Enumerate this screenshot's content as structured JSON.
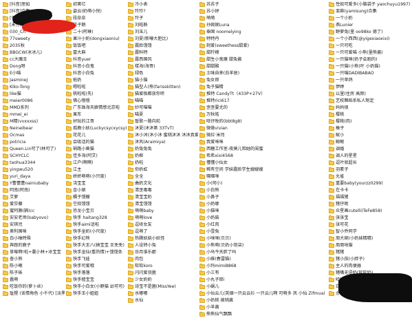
{
  "columns": [
    [
      "[抖音]思如",
      "[抖音]合集",
      "[平台]-抖音号",
      "[未分类]合集",
      "030_Ch",
      "77sweety",
      "2035秋",
      "BBGCW(冰冰儿)",
      "cc大魔王",
      "Dong呀",
      "E小喵",
      "JasmineJ",
      "Kiko-Tong",
      "like猫",
      "meier0086",
      "MMD系列",
      "mmei_ei",
      "M精(vvxxxss)",
      "Neineibear",
      "Ocmas",
      "potricia",
      "Queen.Lin可了(林可了)",
      "SCHYCLC",
      "taohua3344",
      "yingwu520",
      "yuri_daya",
      "Y蕾蕾蕾nainiubaby",
      "阿南(阿南)",
      "艾萝",
      "爱莎藤",
      "蜜阿腩(腩)cc",
      "安安老师(babyovo)",
      "安琪児",
      "奥利国咪",
      "白小柚特殊",
      "奔跑的鹿子",
      "草莓啊!啦+囊小林+冰宝宝",
      "查小熊",
      "陈小曦",
      "陈子砾",
      "蠢萌",
      "吃饭你的(萝卜丝)",
      "耻猩 (谈情角色 小千代) [淡黑]"
    ],
    [
      "初菁亿",
      "姿云(奶萌小悦)",
      "段奈奈",
      "段子鹅",
      "二十(阿琳)",
      "果汁小奶(dongxiaoniu)",
      "饭饭吧",
      "富大麻",
      "抖音yuer",
      "抖音小白鬼",
      "抖音小白兔",
      "抵奶",
      "嗯啦啦",
      "帆啦啦(先)",
      "佛心慢慢",
      "广东珠海天廊情感北京啦",
      "果东",
      "好玩的江哥",
      "孤鹿小妖(Luckycsycxycsy)",
      "花花儿",
      "会吸话的猫",
      "祸路小兽猫",
      "佳多海(阿艾)",
      "江户(啊啊)",
      "江主",
      "娇娇萌萌(小只度)",
      "浇宝宝",
      "金小娘",
      "橘子馒蝗",
      "空寂馒馒",
      "恐龙小宝贝",
      "快手 haitang328",
      "快手aimi话啦",
      "快手坐奶(小尺度)",
      "快手幻熊",
      "快手大王八(搞宝宝 王免免)",
      "快手坐仙(看热情)+馒馒条",
      "快手飞娃",
      "快手可爱哦",
      "快手落落",
      "快手樯宝宝",
      "快手小白女(小野猫 幼可可)",
      "快手王小姐姐"
    ],
    [
      "冷小表",
      "玲玲?",
      "玲子",
      "刘皓鞅",
      "刘玉儿",
      "刘夏(新曝大胆比)",
      "露脸馒馒",
      "露科特",
      "露西国风",
      "楼海(海哥)",
      "绿色",
      "猫小猫",
      "猫型人(熊(farisskitten)",
      "猫爱极都放你听",
      "喵喵",
      "妙可喵喵",
      "喵夏",
      "暂歌一路向前",
      "沐夏(沐沐第 33TvT)",
      "沐小沐(沐小沐 蜜桃沐沐 沐沐真爱蜜)",
      "沐风(Araimiya)",
      "奶兔兔兔",
      "奶柳",
      "奶啦",
      "你奶虹",
      "全全",
      "曲奶文化",
      "清歪毒毒",
      "清宝宝奶",
      "清宝馒馒",
      "萌萌baby",
      "萌萌love",
      "逗哧女友",
      "逗萌了",
      "热腾妖娆小妖怪",
      "人设转小兔",
      "日月谁乐郡",
      "肉包",
      "软软koro",
      "闪闪爱羽菌",
      "少女奶奶",
      "诗宝不是菌(MissYee)",
      "水嘟嘟",
      "水仙"
    ],
    [
      "苏苏子",
      "苏小妤",
      "萌萌",
      "孙婉婉Luna",
      "泰国 noomelying",
      "特特丹",
      "剃爱(sweethess甜爱)",
      "甜柠檬",
      "甜生小鬼魔 甜兔酱",
      "甜甜酸",
      "土味自来(白羊座)",
      "兔女郎",
      "兔子猫精",
      "推特 CandyTt（433P+27V）",
      "推特rici617",
      "歪歪要尤的",
      "万秋皓",
      "旺仔牧的(bbt8g8)",
      "微微vivian",
      "微拉·米司",
      "我爱咪咪",
      "西糖工作室-夜莫儿和她的闺蜜",
      "希希xixi4568",
      "懂懂小仙女",
      "稀有空间 学妹露脸学生嫂嫂嫂",
      "嘱嘱咪",
      "小(何小)",
      "小白熊",
      "小鼻子",
      "小奶哪",
      "小猫咪",
      "小奶鼓",
      "小红肉",
      "小雪兔",
      "小咪咪(贝贝)",
      "小熊萌(贝奶小饱柒)",
      "小马今天胖了吗",
      "小麻(春雷猫)",
      "小玛mimi8868",
      "小三有",
      "小丸子耶i",
      "小蜗儿",
      "小仙云儿(英烟一只云云衫 一只云儿啊 可萌多 凤 小仙 Zifmua)",
      "小奶桃 被桃酱",
      "小羊酱",
      "熊熊仙气飘飘"
    ],
    [
      "性奴可爱多(小脑袋子 yaochuyu1997)",
      "亚麻(yamisung)合集",
      "一个小奶",
      "燕Lunier",
      "野萝兔(里 oo98ko 德了)",
      "一个小西西(@yigexiaoxixi)",
      "一只可吃",
      "一只可爱喵 小熊(里熊酱)",
      "一只猫咪(奶子会跑的)",
      "一只猫(小熊(叶 小奶猫)",
      "一只喵DADIBABAO",
      "一只苹鸽",
      "伊婷",
      "以里(住房 高颜)",
      "艺校舞蹈系私人制定",
      "妈妈很",
      "樱桃",
      "樱桃(肉)",
      "橡子",
      "鱿小",
      "鲸鲍",
      "调婚",
      "调人的星星",
      "逗叶就超长",
      "羽素子",
      "允雀",
      "重要baby(yourzz0299)",
      "在卡卡",
      "福福猪",
      "猪仔呢",
      "众星画cutelli(TeFe858)",
      "张张宝",
      "张可花",
      "智小乔同学",
      "周大婉(小奶妹精精)",
      "周周咕猫",
      "猪猪",
      "猪小孩(小胖子)",
      "主人的肉便器",
      "猪嘴无语奶(软软奶)",
      "哈哈哈哈",
      "白胖大的",
      "송니로즈_treat_me_like_2"
    ]
  ]
}
